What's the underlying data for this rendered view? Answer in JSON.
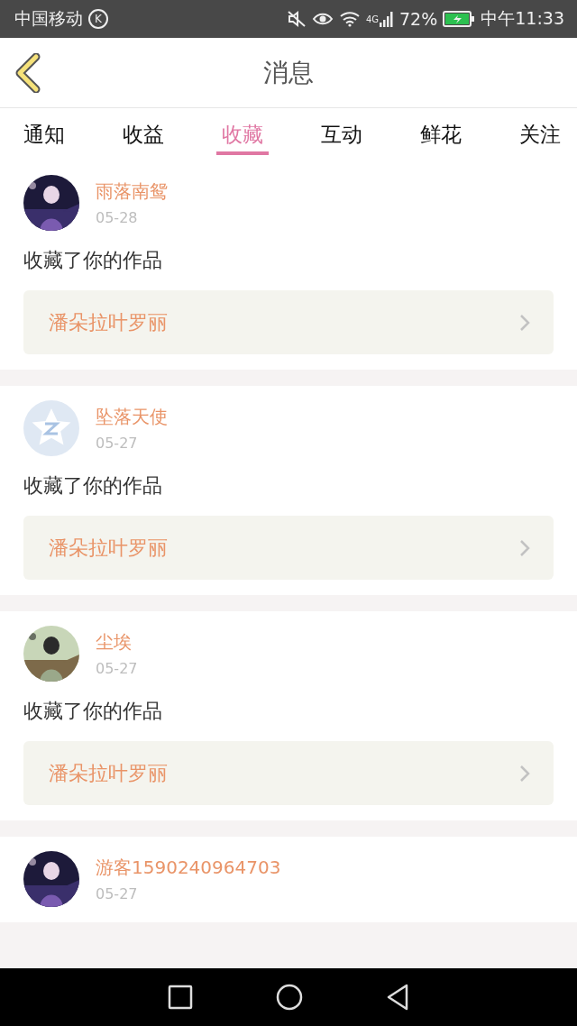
{
  "status_bar": {
    "carrier": "中国移动",
    "carrier_badge": "K",
    "network": "4G",
    "battery": "72%",
    "time": "中午11:33"
  },
  "header": {
    "title": "消息"
  },
  "tabs": [
    {
      "label": "通知",
      "selected": false
    },
    {
      "label": "收益",
      "selected": false
    },
    {
      "label": "收藏",
      "selected": true
    },
    {
      "label": "互动",
      "selected": false
    },
    {
      "label": "鲜花",
      "selected": false
    },
    {
      "label": "关注",
      "selected": false
    }
  ],
  "messages": [
    {
      "name": "雨落南鸳",
      "date": "05-28",
      "text": "收藏了你的作品",
      "work": "潘朵拉叶罗丽"
    },
    {
      "avatar": {
        "kind": "default"
      },
      "name": "坠落天使",
      "date": "05-27",
      "text": "收藏了你的作品",
      "work": "潘朵拉叶罗丽"
    },
    {
      "name": "尘埃",
      "date": "05-27",
      "text": "收藏了你的作品",
      "work": "潘朵拉叶罗丽"
    },
    {
      "name": "游客1590240964703",
      "date": "05-27"
    }
  ]
}
